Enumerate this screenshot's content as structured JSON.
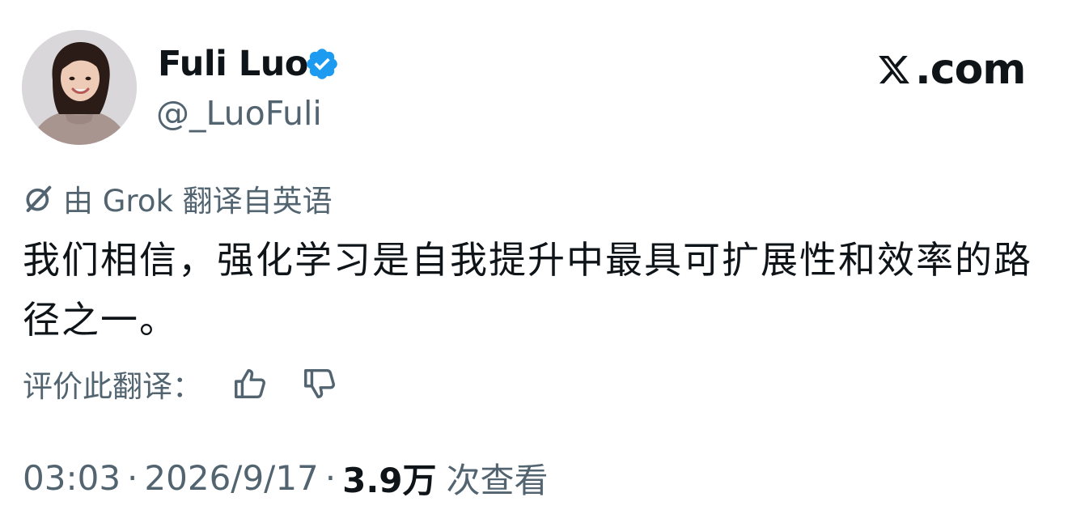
{
  "author": {
    "display_name": "Fuli Luo",
    "handle": "@_LuoFuli",
    "verified_icon": "verified-badge-icon",
    "verified_color": "#1d9bf0"
  },
  "brand": {
    "text": ".com",
    "icon": "x-logo-icon"
  },
  "translation": {
    "icon": "grok-icon",
    "label": "由 Grok 翻译自英语"
  },
  "tweet": {
    "text": "我们相信，强化学习是自我提升中最具可扩展性和效率的路径之一。"
  },
  "rate_translation": {
    "label": "评价此翻译：",
    "like_icon": "thumbs-up-icon",
    "dislike_icon": "thumbs-down-icon"
  },
  "meta": {
    "time": "03:03",
    "separator": "·",
    "date": "2026/9/17",
    "views_count": "3.9万",
    "views_label": "次查看"
  },
  "colors": {
    "text_primary": "#0f1419",
    "text_secondary": "#536471",
    "accent": "#1d9bf0"
  }
}
